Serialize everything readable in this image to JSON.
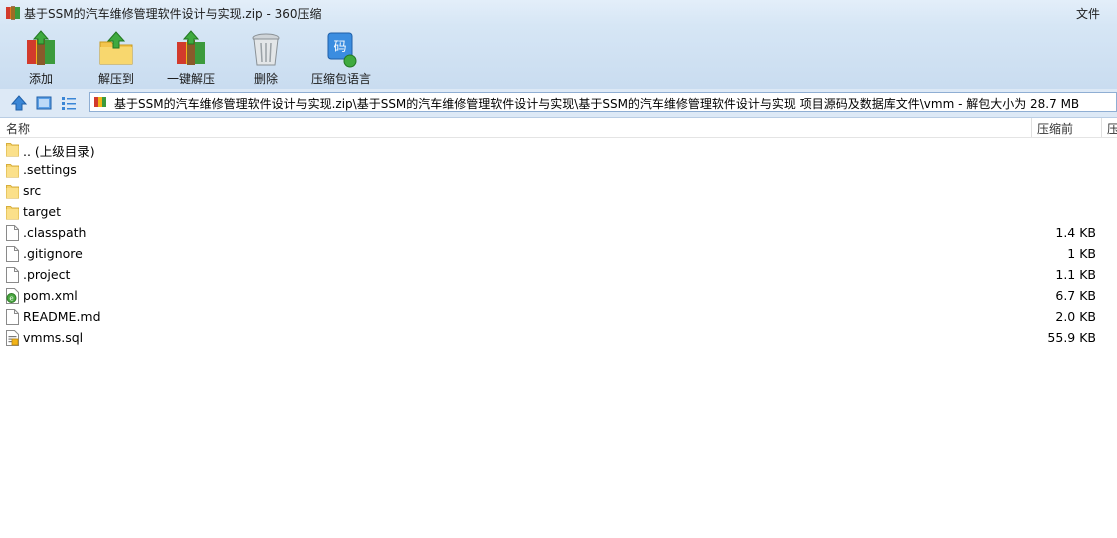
{
  "window": {
    "title": "基于SSM的汽车维修管理软件设计与实现.zip - 360压缩",
    "menu_file": "文件"
  },
  "toolbar": {
    "add_label": "添加",
    "extract_to_label": "解压到",
    "one_click_extract_label": "一键解压",
    "delete_label": "删除",
    "comment_label": "压缩包语言"
  },
  "address": {
    "path": "基于SSM的汽车维修管理软件设计与实现.zip\\基于SSM的汽车维修管理软件设计与实现\\基于SSM的汽车维修管理软件设计与实现 项目源码及数据库文件\\vmm - 解包大小为 28.7 MB"
  },
  "columns": {
    "name": "名称",
    "size": "压缩前",
    "packed": "压"
  },
  "files": [
    {
      "name": ".. (上级目录)",
      "size": "",
      "icon": "folder-icon"
    },
    {
      "name": ".settings",
      "size": "",
      "icon": "folder-icon"
    },
    {
      "name": "src",
      "size": "",
      "icon": "folder-icon"
    },
    {
      "name": "target",
      "size": "",
      "icon": "folder-icon"
    },
    {
      "name": ".classpath",
      "size": "1.4 KB",
      "icon": "file-icon"
    },
    {
      "name": ".gitignore",
      "size": "1 KB",
      "icon": "file-icon"
    },
    {
      "name": ".project",
      "size": "1.1 KB",
      "icon": "file-icon"
    },
    {
      "name": "pom.xml",
      "size": "6.7 KB",
      "icon": "xml-file-icon"
    },
    {
      "name": "README.md",
      "size": "2.0 KB",
      "icon": "file-icon"
    },
    {
      "name": "vmms.sql",
      "size": "55.9 KB",
      "icon": "sql-file-icon"
    }
  ]
}
